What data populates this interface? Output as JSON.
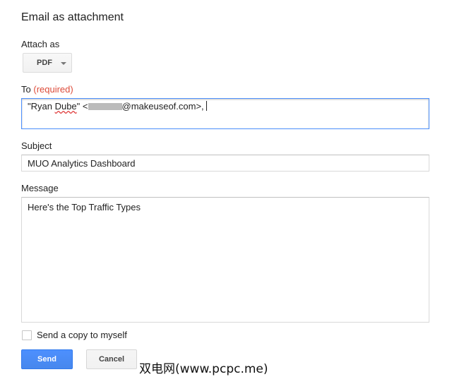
{
  "dialog": {
    "title": "Email as attachment"
  },
  "attach": {
    "label": "Attach as",
    "format": "PDF"
  },
  "to": {
    "label": "To",
    "required_text": "(required)",
    "name": "\"Ryan Dube\"",
    "email_prefix": "<",
    "email_suffix": "@makeuseof.com>,"
  },
  "subject": {
    "label": "Subject",
    "value": "MUO Analytics Dashboard"
  },
  "message": {
    "label": "Message",
    "value": "Here's the Top Traffic Types"
  },
  "copy": {
    "label": "Send a copy to myself",
    "checked": false
  },
  "buttons": {
    "send": "Send",
    "cancel": "Cancel"
  },
  "watermark": "双电网(www.pcpc.me)",
  "colors": {
    "send_blue": "#4d90fe",
    "required_red": "#dd4b39",
    "focus_border": "#4d90fe"
  }
}
